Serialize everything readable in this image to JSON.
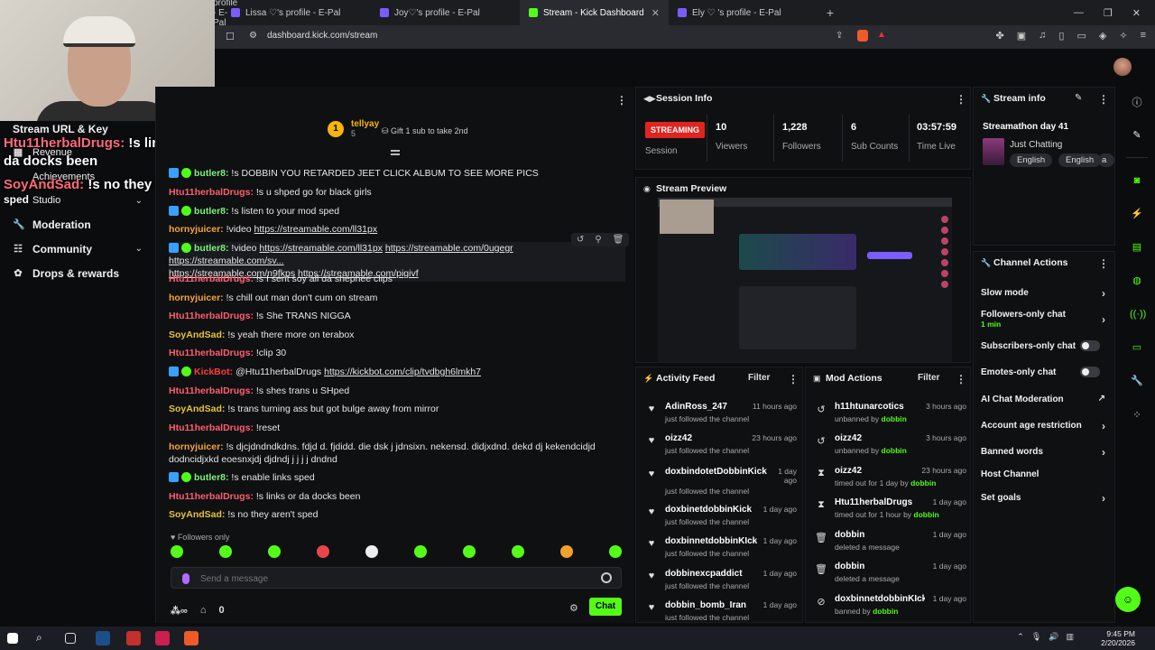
{
  "browser": {
    "tabs": [
      {
        "label": "profile - E-Pal"
      },
      {
        "label": "Lissa ♡'s profile - E-Pal"
      },
      {
        "label": "Joy♡'s profile - E-Pal"
      },
      {
        "label": "Stream - Kick Dashboard",
        "active": true
      },
      {
        "label": "Ely ♡ 's profile - E-Pal"
      }
    ],
    "url": "dashboard.kick.com/stream"
  },
  "overlay": {
    "line1_user": "Htu11herbalDrugs:",
    "line1_msg": "!s links or",
    "line2": "da docks been",
    "line3_user": "SoyAndSad:",
    "line3_msg": "!s no they aren't",
    "line4": "sped"
  },
  "nav": {
    "stream_url": "Stream URL & Key",
    "revenue": "Revenue",
    "achievements": "Achievements",
    "studio": "Studio",
    "moderation": "Moderation",
    "community": "Community",
    "drops": "Drops & rewards"
  },
  "chat": {
    "top_user": "tellyay",
    "top_user_level": "5",
    "top_badge": "1",
    "gift_text": "Gift 1 sub to take 2nd",
    "messages": [
      {
        "user": "butler8:",
        "color": "green",
        "badges": true,
        "text": " !s DOBBIN YOU RETARDED JEET CLICK ALBUM TO SEE MORE PICS"
      },
      {
        "user": "Htu11herbalDrugs:",
        "color": "red",
        "text": " !s u shped go for black girls"
      },
      {
        "user": "butler8:",
        "color": "green",
        "badges": true,
        "text": " !s listen to your mod sped"
      },
      {
        "user": "hornyjuicer:",
        "color": "orange",
        "text": " !video ",
        "link": "https://streamable.com/ll31px"
      },
      {
        "user": "Htu11herbalDrugs:",
        "color": "red",
        "text": " !s I sent soy all da shephee clips"
      },
      {
        "user": "hornyjuicer:",
        "color": "orange",
        "text": " !s chill out man don't cum on stream"
      },
      {
        "user": "Htu11herbalDrugs:",
        "color": "red",
        "text": " !s She TRANS NIGGA"
      },
      {
        "user": "SoyAndSad:",
        "color": "yellow",
        "text": " !s yeah there more on terabox"
      },
      {
        "user": "Htu11herbalDrugs:",
        "color": "red",
        "text": " !clip 30"
      },
      {
        "user": "Htu11herbalDrugs:",
        "color": "red",
        "text": " !s shes trans u SHped"
      },
      {
        "user": "SoyAndSad:",
        "color": "yellow",
        "text": " !s trans turning ass but got bulge away from mirror"
      },
      {
        "user": "Htu11herbalDrugs:",
        "color": "red",
        "text": " !reset"
      },
      {
        "user": "butler8:",
        "color": "green",
        "badges": true,
        "text": " !s enable links sped"
      },
      {
        "user": "Htu11herbalDrugs:",
        "color": "red",
        "text": " !s links or da docks been"
      },
      {
        "user": "SoyAndSad:",
        "color": "yellow",
        "text": " !s no they aren't sped"
      }
    ],
    "multi_video": {
      "user": "butler8:",
      "prefix": " !video ",
      "link1": "https://streamable.com/ll31px",
      "link2": "https://streamable.com/0ugegr",
      "link3": "https://streamable.com/sv...",
      "link4": "https://streamable.com/n9fkps",
      "link5": "https://streamable.com/pigivf"
    },
    "kickbot": {
      "user": "KickBot:",
      "text": " @Htu11herbalDrugs ",
      "link": "https://kickbot.com/clip/tvdbgh6lmkh7"
    },
    "long_msg": {
      "user": "hornyjuicer:",
      "text": " !s djcjdndndkdns. fdjd d. fjdidd. die dsk j jdnsixn. nekensd. didjxdnd. dekd dj kekendcidjd dodncidjxkd eoesnxjdj djdndj j j j j dndnd"
    },
    "followers_only": "Followers only",
    "send_placeholder": "Send a message",
    "points": "0",
    "chat_button": "Chat"
  },
  "session": {
    "title": "Session Info",
    "status": "STREAMING",
    "status_label": "Session",
    "stats": [
      {
        "value": "10",
        "label": "Viewers"
      },
      {
        "value": "1,228",
        "label": "Followers"
      },
      {
        "value": "6",
        "label": "Sub Counts"
      },
      {
        "value": "03:57:59",
        "label": "Time Live"
      }
    ]
  },
  "preview": {
    "title": "Stream Preview"
  },
  "activity": {
    "title": "Activity Feed",
    "filter": "Filter",
    "items": [
      {
        "name": "AdinRoss_247",
        "time": "11 hours ago",
        "desc": "just followed the channel"
      },
      {
        "name": "oizz42",
        "time": "23 hours ago",
        "desc": "just followed the channel"
      },
      {
        "name": "doxbindotetDobbinKick",
        "time": "1 day ago",
        "desc": "just followed the channel"
      },
      {
        "name": "doxbinetdobbinKick",
        "time": "1 day ago",
        "desc": "just followed the channel"
      },
      {
        "name": "doxbinnetdobbinKIck",
        "time": "1 day ago",
        "desc": "just followed the channel"
      },
      {
        "name": "dobbinexcpaddict",
        "time": "1 day ago",
        "desc": "just followed the channel"
      },
      {
        "name": "dobbin_bomb_Iran",
        "time": "1 day ago",
        "desc": "just followed the channel"
      }
    ]
  },
  "mod": {
    "title": "Mod Actions",
    "filter": "Filter",
    "items": [
      {
        "name": "h11htunarcotics",
        "time": "3 hours ago",
        "desc": "unbanned by ",
        "by": "dobbin"
      },
      {
        "name": "oizz42",
        "time": "3 hours ago",
        "desc": "unbanned by ",
        "by": "dobbin"
      },
      {
        "name": "oizz42",
        "time": "23 hours ago",
        "desc": "timed out for 1 day by ",
        "by": "dobbin"
      },
      {
        "name": "Htu11herbalDrugs",
        "time": "1 day ago",
        "desc": "timed out for 1 hour by ",
        "by": "dobbin"
      },
      {
        "name": "dobbin",
        "time": "1 day ago",
        "desc": "deleted a message",
        "by": ""
      },
      {
        "name": "dobbin",
        "time": "1 day ago",
        "desc": "deleted a message",
        "by": ""
      },
      {
        "name": "doxbinnetdobbinKIck",
        "time": "1 day ago",
        "desc": "banned by ",
        "by": "dobbin"
      }
    ]
  },
  "streaminfo": {
    "title": "Stream info",
    "stream_title": "Streamathon day 41",
    "category": "Just Chatting",
    "tags": [
      "English",
      "English",
      "a"
    ]
  },
  "actions": {
    "title": "Channel Actions",
    "slow_mode": "Slow mode",
    "followers_only": "Followers-only chat",
    "followers_only_sub": "1 min",
    "subs_only": "Subscribers-only chat",
    "emotes_only": "Emotes-only chat",
    "ai_mod": "AI Chat Moderation",
    "age_restriction": "Account age restriction",
    "banned_words": "Banned words",
    "host": "Host Channel",
    "goals": "Set goals"
  },
  "taskbar": {
    "time": "9:45 PM",
    "date": "2/20/2026"
  }
}
